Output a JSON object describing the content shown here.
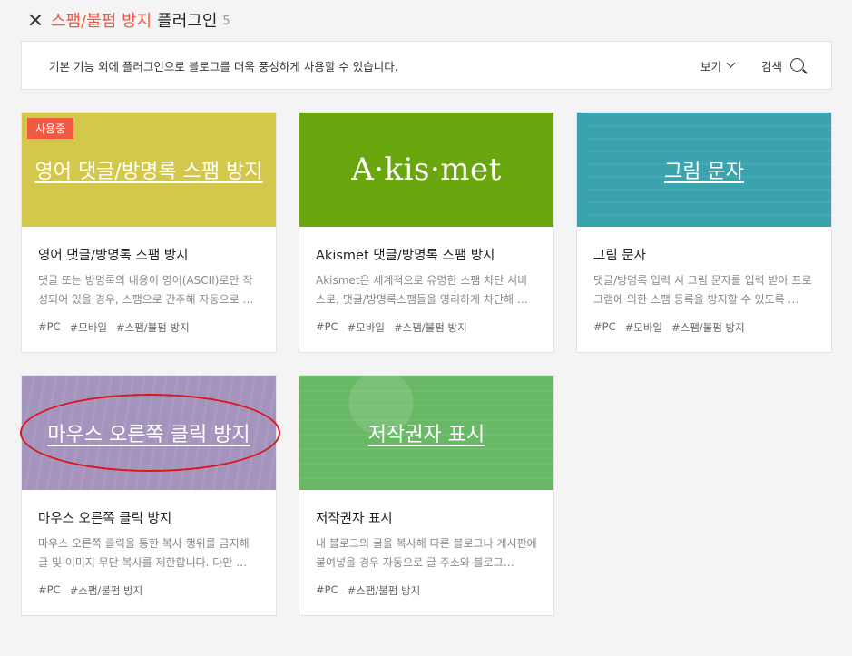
{
  "header": {
    "title_accent": "스팸/불펌 방지",
    "title_rest": "플러그인",
    "count": "5"
  },
  "infobar": {
    "description": "기본 기능 외에 플러그인으로 블로그를 더욱 풍성하게 사용할 수 있습니다.",
    "view_label": "보기",
    "search_label": "검색"
  },
  "cards": [
    {
      "thumb_title": "영어 댓글/방명록 스팸 방지",
      "badge": "사용중",
      "name": "영어 댓글/방명록 스팸 방지",
      "summary": "댓글 또는 방명록의 내용이 영어(ASCII)로만 작성되어 있을 경우, 스팸으로 간주해 자동으로 …",
      "tags": [
        "#PC",
        "#모바일",
        "#스팸/불펌 방지"
      ],
      "color": "#d3c84c"
    },
    {
      "thumb_title": "A·kis·met",
      "name": "Akismet 댓글/방명록 스팸 방지",
      "summary": "Akismet은 세계적으로 유명한 스팸 차단 서비스로, 댓글/방명록스팸들을 영리하게 차단해 …",
      "tags": [
        "#PC",
        "#모바일",
        "#스팸/불펌 방지"
      ],
      "color": "#6aa60e"
    },
    {
      "thumb_title": "그림 문자",
      "name": "그림 문자",
      "summary": "댓글/방명록 입력 시 그림 문자를 입력 받아 프로그램에 의한 스팸 등록을 방지할 수 있도록 …",
      "tags": [
        "#PC",
        "#모바일",
        "#스팸/불펌 방지"
      ],
      "color": "#3aa3ad"
    },
    {
      "thumb_title": "마우스 오른쪽 클릭 방지",
      "name": "마우스 오른쪽 클릭 방지",
      "summary": "마우스 오른쪽 클릭을 통한 복사 행위를 금지해 글 및 이미지 무단 복사를 제한합니다. 다만 …",
      "tags": [
        "#PC",
        "#스팸/불펌 방지"
      ],
      "color": "#a493bd"
    },
    {
      "thumb_title": "저작권자 표시",
      "name": "저작권자 표시",
      "summary": "내 블로그의 글을 복사해 다른 블로그나 게시판에 붙여넣을 경우 자동으로 글 주소와 블로그…",
      "tags": [
        "#PC",
        "#스팸/불펌 방지"
      ],
      "color": "#68b866"
    }
  ]
}
